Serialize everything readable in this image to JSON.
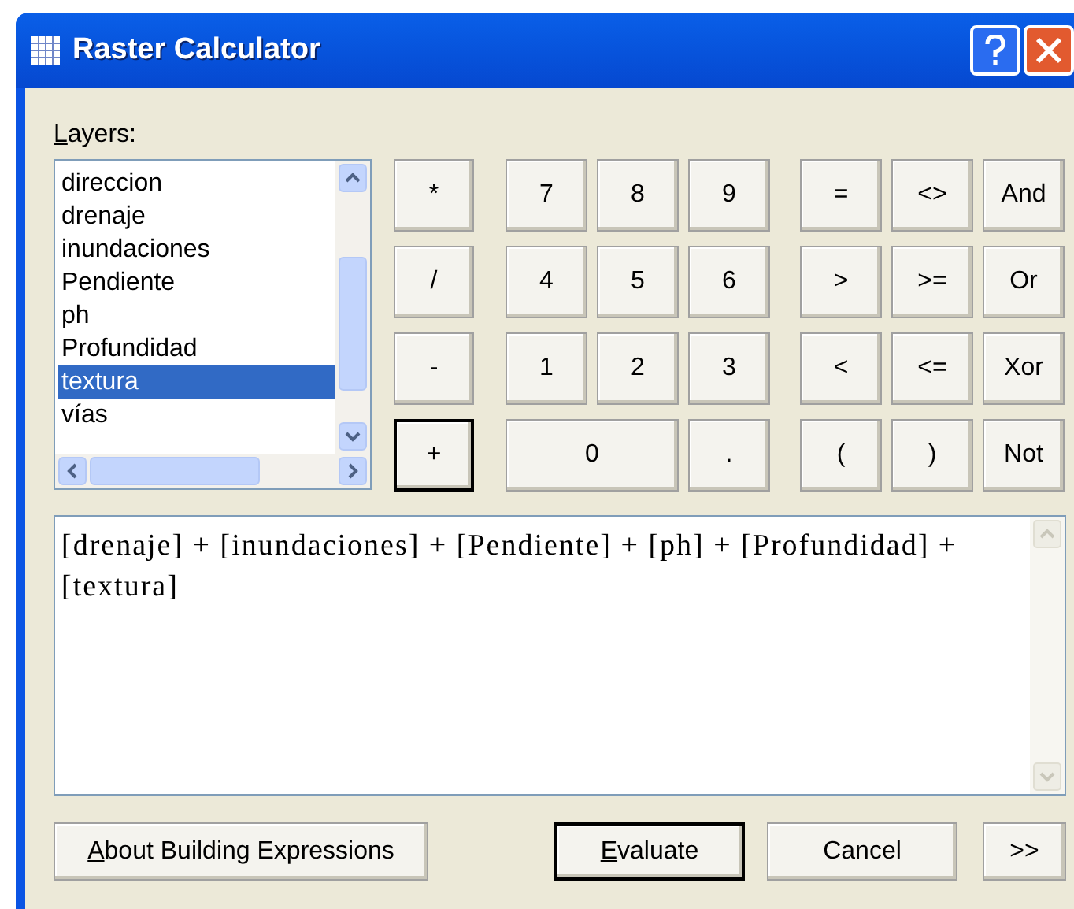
{
  "window": {
    "title": "Raster Calculator"
  },
  "layers": {
    "label": "Layers:",
    "mnemonic": true,
    "items": [
      {
        "name": "direccion",
        "selected": false
      },
      {
        "name": "drenaje",
        "selected": false
      },
      {
        "name": "inundaciones",
        "selected": false
      },
      {
        "name": "Pendiente",
        "selected": false
      },
      {
        "name": "ph",
        "selected": false
      },
      {
        "name": "Profundidad",
        "selected": false
      },
      {
        "name": "textura",
        "selected": true
      },
      {
        "name": "vías",
        "selected": false
      }
    ]
  },
  "keypad": {
    "operators": [
      {
        "label": "*",
        "default": false
      },
      {
        "label": "/",
        "default": false
      },
      {
        "label": "-",
        "default": false
      },
      {
        "label": "+",
        "default": true
      }
    ],
    "numbers": [
      {
        "label": "7",
        "wide": false
      },
      {
        "label": "8",
        "wide": false
      },
      {
        "label": "9",
        "wide": false
      },
      {
        "label": "4",
        "wide": false
      },
      {
        "label": "5",
        "wide": false
      },
      {
        "label": "6",
        "wide": false
      },
      {
        "label": "1",
        "wide": false
      },
      {
        "label": "2",
        "wide": false
      },
      {
        "label": "3",
        "wide": false
      },
      {
        "label": "0",
        "wide": true
      },
      {
        "label": ".",
        "wide": false
      }
    ],
    "logic": [
      "=",
      "<>",
      "And",
      ">",
      ">=",
      "Or",
      "<",
      "<=",
      "Xor",
      "(",
      ")",
      "Not"
    ]
  },
  "expression": "[drenaje] + [inundaciones] + [Pendiente] + [ph] + [Profundidad] + [textura]",
  "buttons": [
    {
      "label": "About Building Expressions",
      "mnemonic": true,
      "default": false
    },
    {
      "label": "Evaluate",
      "mnemonic": true,
      "default": true
    },
    {
      "label": "Cancel",
      "mnemonic": false,
      "default": false
    },
    {
      "label": ">>",
      "mnemonic": false,
      "default": false
    }
  ]
}
